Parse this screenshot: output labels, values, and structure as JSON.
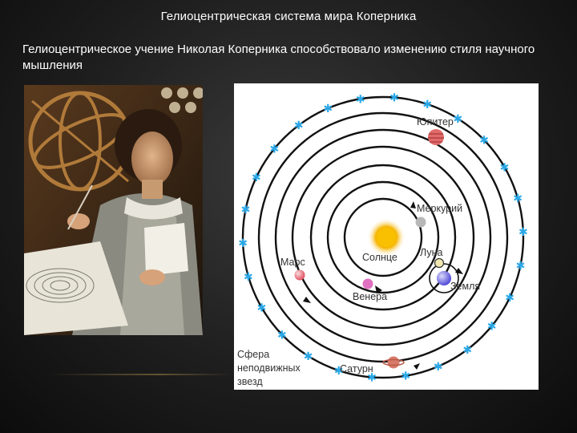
{
  "slide": {
    "title": "Гелиоцентрическая система мира Коперника",
    "subtitle": "Гелиоцентрическое учение Николая Коперника способствовало изменению стиля научного мышления"
  },
  "diagram": {
    "labels": {
      "jupiter": "Юпитер",
      "mercury": "Меркурий",
      "sun": "Солнце",
      "moon": "Луна",
      "mars": "Марс",
      "earth": "Земля",
      "venus": "Венера",
      "saturn": "Сатурн",
      "sphere_line1": "Сфера",
      "sphere_line2": "неподвижных",
      "sphere_line3": "звезд"
    },
    "colors": {
      "orbit": "#111111",
      "sun": "#f5b400",
      "mercury": "#b8b8b8",
      "venus": "#e070c0",
      "earth": "#4a44d8",
      "mars": "#e04a5a",
      "jupiter": "#e06a6a",
      "saturn": "#d87a6a",
      "stars": "#2aa8e8",
      "text": "#333333"
    }
  }
}
